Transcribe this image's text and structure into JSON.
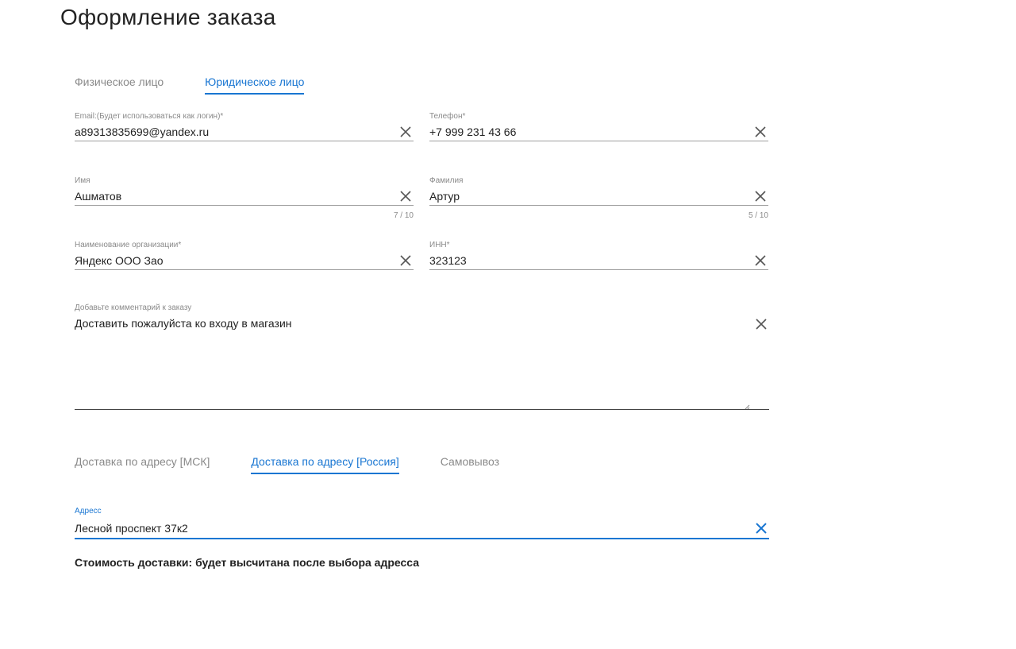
{
  "page": {
    "title": "Оформление заказа"
  },
  "customer_tabs": [
    {
      "label": "Физическое лицо",
      "active": false
    },
    {
      "label": "Юридическое лицо",
      "active": true
    }
  ],
  "fields": {
    "email": {
      "label": "Email:(Будет использоваться как логин)*",
      "value": "a89313835699@yandex.ru"
    },
    "phone": {
      "label": "Телефон*",
      "value": "+7 999 231 43 66"
    },
    "first_name": {
      "label": "Имя",
      "value": "Ашматов",
      "counter": "7 / 10"
    },
    "last_name": {
      "label": "Фамилия",
      "value": "Артур",
      "counter": "5 / 10"
    },
    "organization": {
      "label": "Наименование организации*",
      "value": "Яндекс ООО Зао"
    },
    "inn": {
      "label": "ИНН*",
      "value": "323123"
    },
    "comment": {
      "label": "Добавьте комментарий к заказу",
      "value": "Доставить пожалуйста ко входу в магазин"
    },
    "address": {
      "label": "Адресс",
      "value": "Лесной проспект 37к2"
    }
  },
  "delivery_tabs": [
    {
      "label": "Доставка по адресу [МСК]",
      "active": false
    },
    {
      "label": "Доставка по адресу [Россия]",
      "active": true
    },
    {
      "label": "Самовывоз",
      "active": false
    }
  ],
  "delivery_cost": "Стоимость доставки: будет высчитана после выбора адресса",
  "colors": {
    "accent": "#1976d2",
    "muted": "#8a8a8a",
    "text": "#222222"
  }
}
